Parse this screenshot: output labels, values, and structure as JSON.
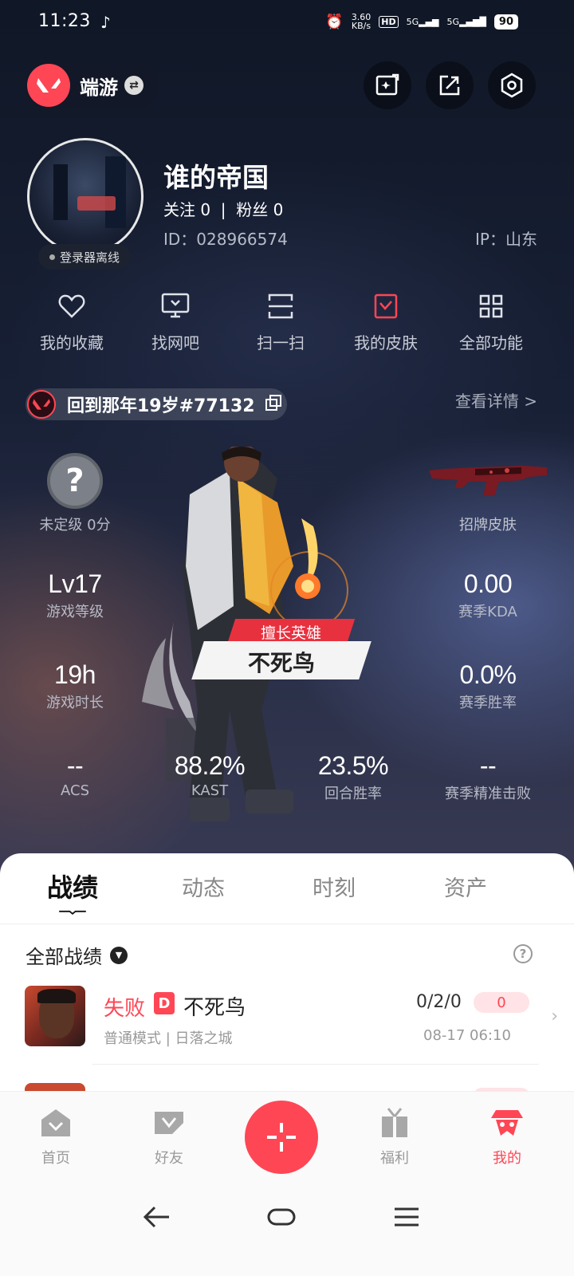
{
  "status_bar": {
    "time": "11:23",
    "net_speed": "3.60\nKB/s",
    "hd": "HD",
    "sig1": "5G",
    "sig2": "5G",
    "battery": "90"
  },
  "header": {
    "app_name": "端游",
    "buttons": [
      "edit-card-icon",
      "share-icon",
      "settings-icon"
    ]
  },
  "profile": {
    "username": "谁的帝国",
    "follow_text": "关注 0  |  粉丝 0",
    "id_text": "ID：028966574",
    "ip_text": "IP：山东",
    "status": "登录器离线"
  },
  "functions": [
    {
      "label": "我的收藏",
      "icon": "heart-icon"
    },
    {
      "label": "找网吧",
      "icon": "monitor-icon"
    },
    {
      "label": "扫一扫",
      "icon": "scan-icon"
    },
    {
      "label": "我的皮肤",
      "icon": "skin-icon"
    },
    {
      "label": "全部功能",
      "icon": "grid-icon"
    }
  ],
  "account": {
    "name": "回到那年19岁#77132",
    "detail_link": "查看详情 >"
  },
  "stats": {
    "rank": {
      "symbol": "?",
      "label": "未定级 0分"
    },
    "signature_skin_label": "招牌皮肤",
    "level": {
      "value": "Lv17",
      "label": "游戏等级"
    },
    "kda": {
      "value": "0.00",
      "label": "赛季KDA"
    },
    "hours": {
      "value": "19h",
      "label": "游戏时长"
    },
    "winrate": {
      "value": "0.0%",
      "label": "赛季胜率"
    },
    "acs": {
      "value": "--",
      "label": "ACS"
    },
    "kast": {
      "value": "88.2%",
      "label": "KAST"
    },
    "round_win": {
      "value": "23.5%",
      "label": "回合胜率"
    },
    "precise_kill": {
      "value": "--",
      "label": "赛季精准击败"
    }
  },
  "hero": {
    "badge_title": "擅长英雄",
    "name": "不死鸟"
  },
  "tabs": [
    {
      "label": "战绩",
      "active": true
    },
    {
      "label": "动态",
      "active": false
    },
    {
      "label": "时刻",
      "active": false
    },
    {
      "label": "资产",
      "active": false
    }
  ],
  "records": {
    "filter": "全部战绩",
    "matches": [
      {
        "result": "失败",
        "tag": "D",
        "agent": "不死鸟",
        "kda": "0/2/0",
        "score": "0",
        "mode": "普通模式 | 日落之城",
        "time": "08-17 06:10"
      }
    ]
  },
  "bottom_nav": [
    {
      "label": "首页",
      "icon": "home-icon"
    },
    {
      "label": "好友",
      "icon": "friends-icon"
    },
    {
      "label": "",
      "icon": "plus-icon"
    },
    {
      "label": "福利",
      "icon": "gift-icon"
    },
    {
      "label": "我的",
      "icon": "profile-agent-icon",
      "active": true
    }
  ],
  "colors": {
    "accent": "#ff4655",
    "hero_bg_top": "#101726",
    "hero_bg_bottom": "#3a3b55"
  }
}
